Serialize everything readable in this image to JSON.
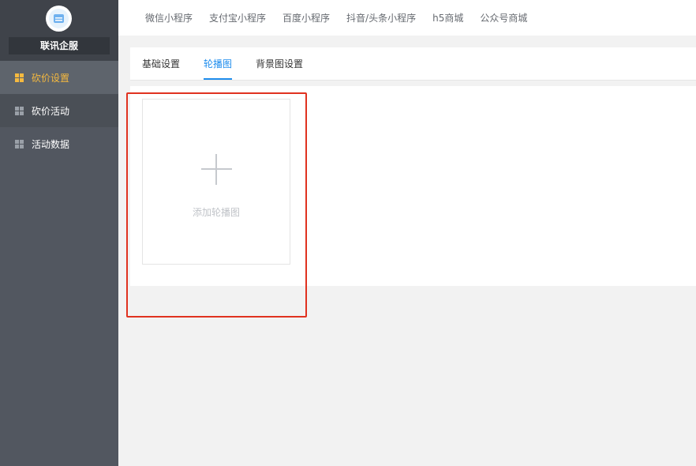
{
  "sidebar": {
    "brand_name": "联讯企服",
    "items": [
      {
        "label": "砍价设置",
        "active": true
      },
      {
        "label": "砍价活动",
        "active": false
      },
      {
        "label": "活动数据",
        "active": false
      }
    ]
  },
  "topnav": {
    "items": [
      "微信小程序",
      "支付宝小程序",
      "百度小程序",
      "抖音/头条小程序",
      "h5商城",
      "公众号商城"
    ]
  },
  "tabs": [
    {
      "label": "基础设置",
      "active": false
    },
    {
      "label": "轮播图",
      "active": true
    },
    {
      "label": "背景图设置",
      "active": false
    }
  ],
  "upload": {
    "label": "添加轮播图"
  },
  "colors": {
    "sidebar_bg": "#525760",
    "active_menu": "#f5b93f",
    "tab_active": "#1f8ded",
    "highlight": "#e0321f"
  }
}
